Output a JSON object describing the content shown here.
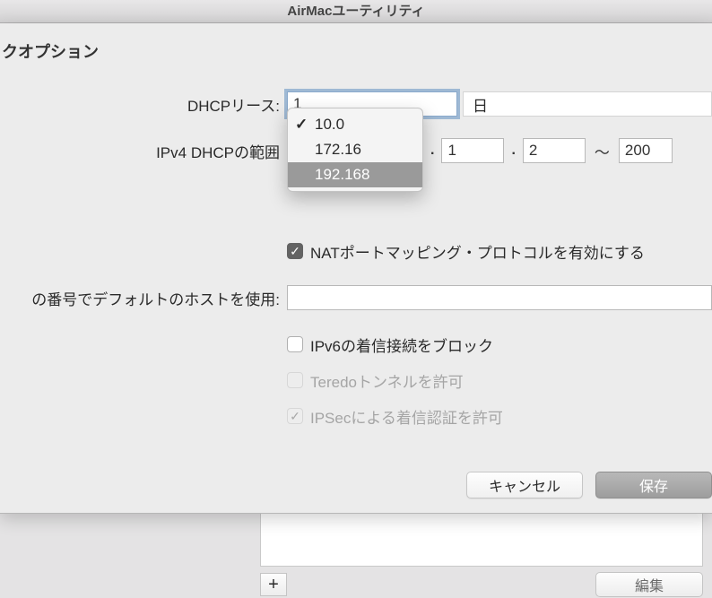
{
  "window": {
    "title": "AirMacユーティリティ"
  },
  "section": {
    "title": "クオプション"
  },
  "dhcp_lease": {
    "label": "DHCPリース:",
    "value": "1",
    "unit": "日"
  },
  "dhcp_range": {
    "label": "IPv4 DHCPの範囲",
    "options": [
      "10.0",
      "172.16",
      "192.168"
    ],
    "selected_index": 0,
    "highlight_index": 2,
    "second": "1",
    "start_host": "2",
    "end_host": "200",
    "tilde": "〜"
  },
  "nat": {
    "checked": true,
    "label": "NATポートマッピング・プロトコルを有効にする"
  },
  "default_host": {
    "label": "の番号でデフォルトのホストを使用:",
    "value": ""
  },
  "ipv6_block": {
    "checked": false,
    "label": "IPv6の着信接続をブロック"
  },
  "teredo": {
    "checked": false,
    "disabled": true,
    "label": "Teredoトンネルを許可"
  },
  "ipsec": {
    "checked": true,
    "disabled": true,
    "label": "IPSecによる着信認証を許可"
  },
  "buttons": {
    "cancel": "キャンセル",
    "save": "保存"
  },
  "lower": {
    "plus": "+",
    "edit": "編集"
  }
}
